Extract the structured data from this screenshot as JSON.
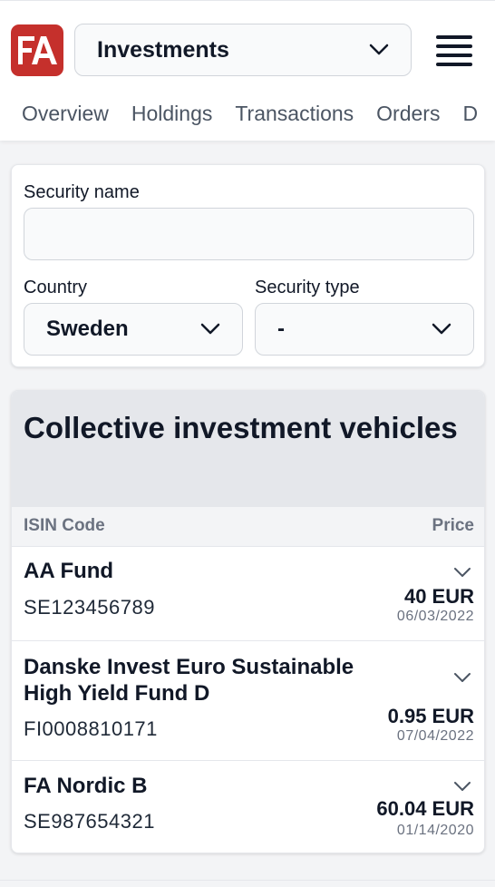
{
  "header": {
    "logo_text": "FA",
    "logo_color": "#c5302c",
    "portfolio_selector": "Investments",
    "menu_icon": "hamburger-icon"
  },
  "tabs": [
    {
      "label": "Overview"
    },
    {
      "label": "Holdings"
    },
    {
      "label": "Transactions"
    },
    {
      "label": "Orders"
    },
    {
      "label": "D"
    }
  ],
  "filters": {
    "security_name_label": "Security name",
    "security_name_value": "",
    "country_label": "Country",
    "country_value": "Sweden",
    "security_type_label": "Security type",
    "security_type_value": "-"
  },
  "results": {
    "title": "Collective investment vehicles",
    "col_isin": "ISIN Code",
    "col_price": "Price",
    "rows": [
      {
        "name": "AA Fund",
        "isin": "SE123456789",
        "price": "40 EUR",
        "date": "06/03/2022"
      },
      {
        "name": "Danske Invest Euro Sustainable High Yield Fund D",
        "isin": "FI0008810171",
        "price": "0.95 EUR",
        "date": "07/04/2022"
      },
      {
        "name": "FA Nordic B",
        "isin": "SE987654321",
        "price": "60.04 EUR",
        "date": "01/14/2020"
      }
    ]
  }
}
